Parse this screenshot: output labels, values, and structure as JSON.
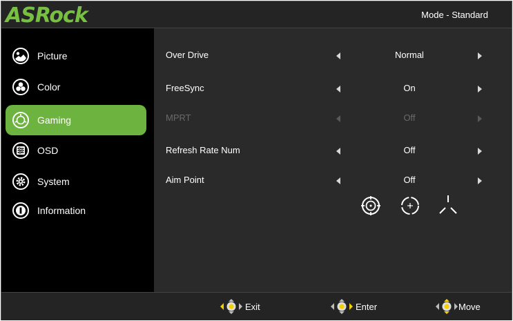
{
  "header": {
    "logo_text": "ASRock",
    "mode_text": "Mode - Standard"
  },
  "sidebar": {
    "items": [
      {
        "label": "Picture",
        "icon": "picture-icon",
        "active": false
      },
      {
        "label": "Color",
        "icon": "color-icon",
        "active": false
      },
      {
        "label": "Gaming",
        "icon": "gaming-icon",
        "active": true
      },
      {
        "label": "OSD",
        "icon": "osd-icon",
        "active": false
      },
      {
        "label": "System",
        "icon": "system-icon",
        "active": false
      },
      {
        "label": "Information",
        "icon": "information-icon",
        "active": false
      }
    ]
  },
  "settings": {
    "rows": [
      {
        "label": "Over Drive",
        "value": "Normal",
        "enabled": true
      },
      {
        "label": "FreeSync",
        "value": "On",
        "enabled": true
      },
      {
        "label": "MPRT",
        "value": "Off",
        "enabled": false
      },
      {
        "label": "Refresh Rate Num",
        "value": "Off",
        "enabled": true
      },
      {
        "label": "Aim Point",
        "value": "Off",
        "enabled": true
      }
    ],
    "aim_point_options": [
      "crosshair-circle-icon",
      "dot-circle-icon",
      "tri-line-crosshair-icon"
    ]
  },
  "footer": {
    "exit_label": "Exit",
    "enter_label": "Enter",
    "move_label": "Move"
  },
  "colors": {
    "accent": "#6db33f",
    "logo": "#77c041",
    "joystick_center": "#f5d000"
  }
}
